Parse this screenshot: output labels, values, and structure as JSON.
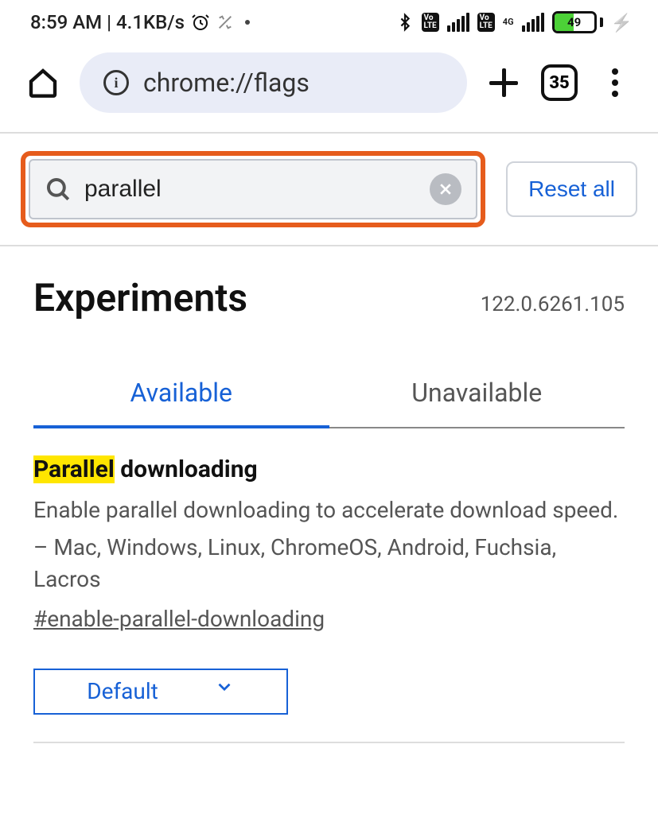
{
  "statusbar": {
    "time_speed": "8:59 AM | 4.1KB/s",
    "network_label": "4G",
    "battery_percent": "49"
  },
  "toolbar": {
    "url": "chrome://flags",
    "tab_count": "35"
  },
  "search": {
    "value": "parallel",
    "reset_label": "Reset all"
  },
  "header": {
    "title": "Experiments",
    "version": "122.0.6261.105"
  },
  "tabs": {
    "available": "Available",
    "unavailable": "Unavailable"
  },
  "flag": {
    "title_highlight": "Parallel",
    "title_rest": " downloading",
    "desc_line1": "Enable parallel downloading to accelerate download speed.",
    "desc_line2": "– Mac, Windows, Linux, ChromeOS, Android, Fuchsia, Lacros",
    "id": "#enable-parallel-downloading",
    "dropdown_value": "Default"
  }
}
